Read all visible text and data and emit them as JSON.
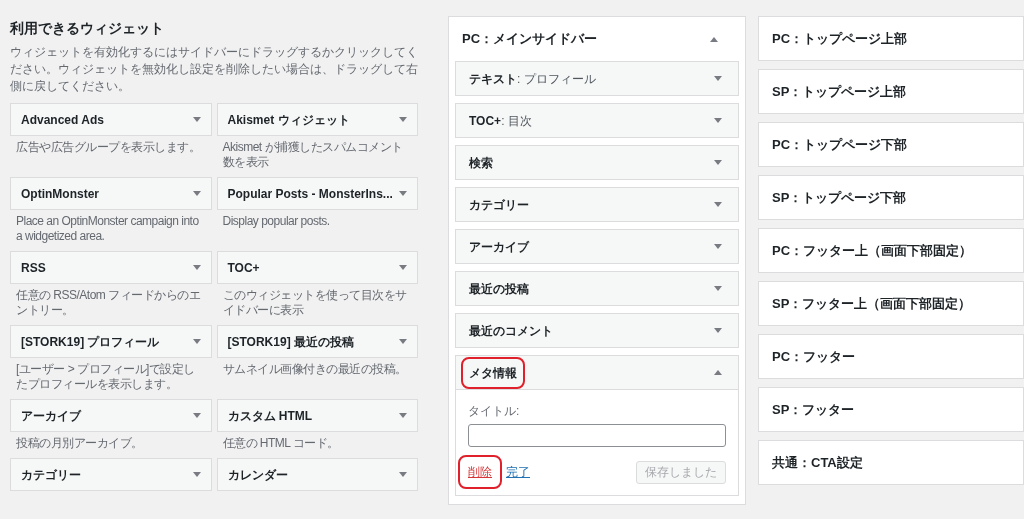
{
  "available": {
    "title": "利用できるウィジェット",
    "description": "ウィジェットを有効化するにはサイドバーにドラッグするかクリックしてください。ウィジェットを無効化し設定を削除したい場合は、ドラッグして右側に戻してください。",
    "widgets": [
      {
        "name": "Advanced Ads",
        "description": "広告や広告グループを表示します。"
      },
      {
        "name": "Akismet ウィジェット",
        "description": "Akismet が捕獲したスパムコメント数を表示"
      },
      {
        "name": "OptinMonster",
        "description": "Place an OptinMonster campaign into a widgetized area."
      },
      {
        "name": "Popular Posts - MonsterIns...",
        "description": "Display popular posts."
      },
      {
        "name": "RSS",
        "description": "任意の RSS/Atom フィードからのエントリー。"
      },
      {
        "name": "TOC+",
        "description": "このウィジェットを使って目次をサイドバーに表示"
      },
      {
        "name": "[STORK19] プロフィール",
        "description": "[ユーザー > プロフィール]で設定したプロフィールを表示します。"
      },
      {
        "name": "[STORK19] 最近の投稿",
        "description": "サムネイル画像付きの最近の投稿。"
      },
      {
        "name": "アーカイブ",
        "description": "投稿の月別アーカイブ。"
      },
      {
        "name": "カスタム HTML",
        "description": "任意の HTML コード。"
      },
      {
        "name": "カテゴリー"
      },
      {
        "name": "カレンダー"
      }
    ]
  },
  "main_sidebar": {
    "title": "PC：メインサイドバー",
    "expanded": true,
    "widgets": [
      {
        "name": "テキスト",
        "subtitle": ": プロフィール",
        "expanded": false,
        "annotated": false
      },
      {
        "name": "TOC+",
        "subtitle": ": 目次",
        "expanded": false,
        "annotated": false
      },
      {
        "name": "検索",
        "expanded": false,
        "annotated": false
      },
      {
        "name": "カテゴリー",
        "expanded": false,
        "annotated": false
      },
      {
        "name": "アーカイブ",
        "expanded": false,
        "annotated": false
      },
      {
        "name": "最近の投稿",
        "expanded": false,
        "annotated": false
      },
      {
        "name": "最近のコメント",
        "expanded": false,
        "annotated": false
      },
      {
        "name": "メタ情報",
        "expanded": true,
        "annotated": true,
        "form": {
          "title_label": "タイトル:",
          "delete_link": "削除",
          "delete_annotated": true,
          "done_link": "完了",
          "save_button": "保存しました",
          "save_disabled": true
        }
      }
    ]
  },
  "other_sidebars": [
    {
      "title": "PC：トップページ上部"
    },
    {
      "title": "SP：トップページ上部"
    },
    {
      "title": "PC：トップページ下部"
    },
    {
      "title": "SP：トップページ下部"
    },
    {
      "title": "PC：フッター上（画面下部固定）"
    },
    {
      "title": "SP：フッター上（画面下部固定）"
    },
    {
      "title": "PC：フッター"
    },
    {
      "title": "SP：フッター"
    },
    {
      "title": "共通：CTA設定"
    }
  ]
}
